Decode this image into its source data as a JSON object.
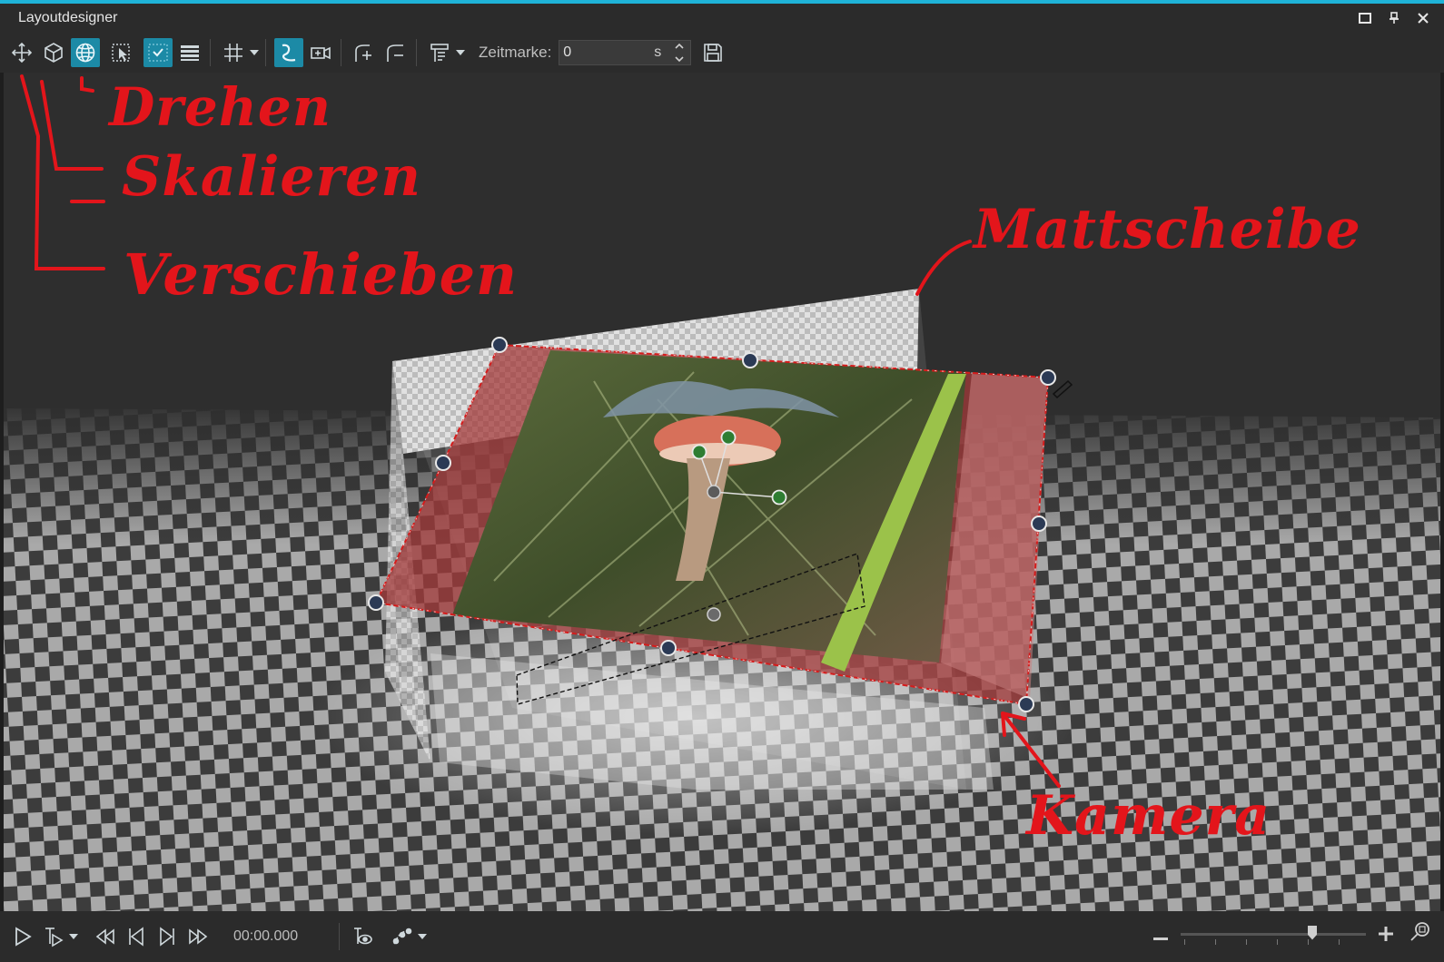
{
  "window": {
    "title": "Layoutdesigner",
    "controls": {
      "maximize": "🗖",
      "pin": "📌",
      "close": "✕"
    }
  },
  "toolbar": {
    "tools": [
      {
        "id": "move",
        "icon": "move-arrows-icon",
        "active": false
      },
      {
        "id": "scale",
        "icon": "cube-icon",
        "active": false
      },
      {
        "id": "rotate",
        "icon": "globe-icon",
        "active": true
      },
      {
        "id": "select",
        "icon": "selection-cursor-icon",
        "active": false
      },
      {
        "id": "snap",
        "icon": "snap-check-icon",
        "active": true
      },
      {
        "id": "layers",
        "icon": "layers-icon",
        "active": false
      },
      {
        "id": "grid",
        "icon": "grid-icon",
        "active": false
      },
      {
        "id": "path",
        "icon": "curve-path-icon",
        "active": true
      },
      {
        "id": "camera",
        "icon": "camera-icon",
        "active": false
      },
      {
        "id": "add-keyframe",
        "icon": "add-keyframe-icon",
        "active": false
      },
      {
        "id": "remove-keyframe",
        "icon": "remove-keyframe-icon",
        "active": false
      },
      {
        "id": "align",
        "icon": "align-icon",
        "active": false
      }
    ],
    "timestamp_label": "Zeitmarke:",
    "timestamp_value": "0",
    "timestamp_unit": "s"
  },
  "annotations": {
    "drehen": "Drehen",
    "skalieren": "Skalieren",
    "verschieben": "Verschieben",
    "mattscheibe": "Mattscheibe",
    "kamera": "Kamera"
  },
  "colors": {
    "accent": "#1fb3d8",
    "active_tool": "#1c8aa6",
    "annotation": "#e3151b",
    "handle": "#2b3a55",
    "pivot_handle": "#2e7d32"
  },
  "bottombar": {
    "timecode": "00:00.000",
    "zoom_level": 0.72
  }
}
